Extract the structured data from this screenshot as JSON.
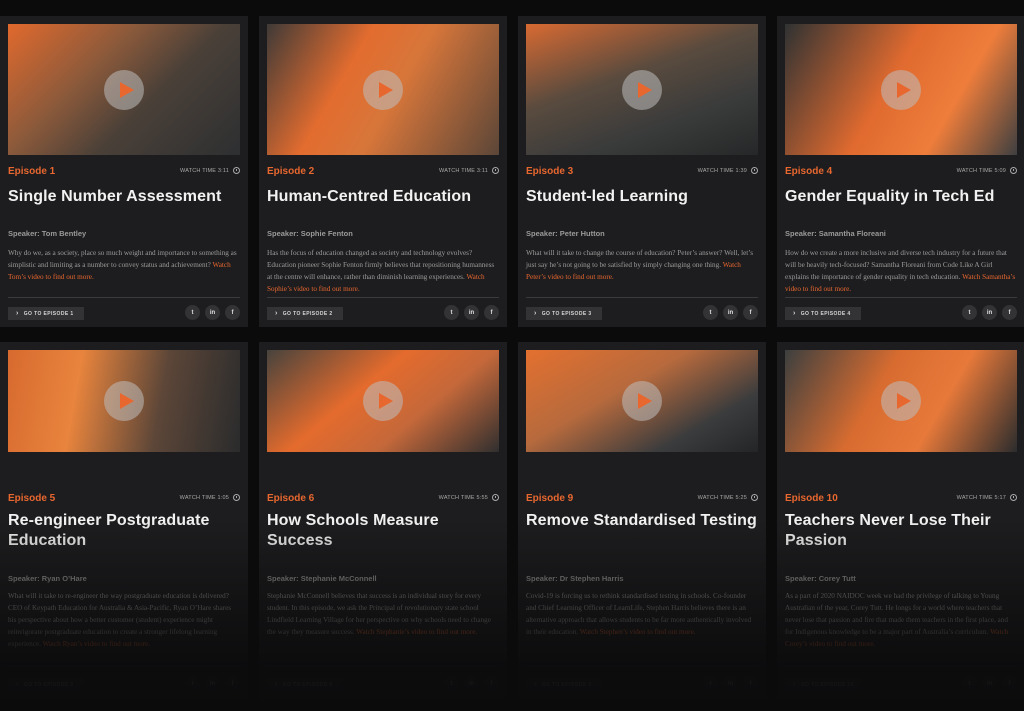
{
  "cards": [
    {
      "episode": "Episode 1",
      "watch": "WATCH TIME 3:11",
      "title": "Single Number Assessment",
      "speaker": "Speaker: Tom Bentley",
      "desc": "Why do we, as a society, place so much weight and importance to something as simplistic and limiting as a number to convey status and achievement?",
      "link": "Watch Tom’s video to find out more.",
      "go": "GO TO EPISODE 1"
    },
    {
      "episode": "Episode 2",
      "watch": "WATCH TIME 3:11",
      "title": "Human-Centred Education",
      "speaker": "Speaker: Sophie Fenton",
      "desc": "Has the focus of education changed as society and technology evolves? Education pioneer Sophie Fenton firmly believes that repositioning humanness at the centre will enhance, rather than diminish learning experiences.",
      "link": "Watch Sophie’s video to find out more.",
      "go": "GO TO EPISODE 2"
    },
    {
      "episode": "Episode 3",
      "watch": "WATCH TIME 1:39",
      "title": "Student-led Learning",
      "speaker": "Speaker: Peter Hutton",
      "desc": "What will it take to change the course of education? Peter’s answer? Well, let’s just say he’s not going to be satisfied by simply changing one thing.",
      "link": "Watch Peter’s video to find out more.",
      "go": "GO TO EPISODE 3"
    },
    {
      "episode": "Episode 4",
      "watch": "WATCH TIME 5:09",
      "title": "Gender Equality in Tech Ed",
      "speaker": "Speaker: Samantha Floreani",
      "desc": "How do we create a more inclusive and diverse tech industry for a future that will be heavily tech-focused? Samantha Floreani from Code Like A Girl explains the importance of gender equality in tech education.",
      "link": "Watch Samantha’s video to find out more.",
      "go": "GO TO EPISODE 4"
    },
    {
      "episode": "Episode 5",
      "watch": "WATCH TIME 1:05",
      "title": "Re-engineer Postgraduate Education",
      "speaker": "Speaker: Ryan O’Hare",
      "desc": "What will it take to re-engineer the way postgraduate education is delivered? CEO of Keypath Education for Australia & Asia-Pacific, Ryan O’Hare shares his perspective about how a better customer (student) experience might reinvigorate postgraduate education to create a stronger lifelong learning experience.",
      "link": "Watch Ryan’s video to find out more.",
      "go": "GO TO EPISODE 5"
    },
    {
      "episode": "Episode 6",
      "watch": "WATCH TIME 5:55",
      "title": "How Schools Measure Success",
      "speaker": "Speaker: Stephanie McConnell",
      "desc": "Stephanie McConnell believes that success is an individual story for every student. In this episode, we ask the Principal of revolutionary state school Lindfield Learning Village for her perspective on why schools need to change the way they measure success.",
      "link": "Watch Stephanie’s video to find out more.",
      "go": "GO TO EPISODE 6"
    },
    {
      "episode": "Episode 9",
      "watch": "WATCH TIME 5:25",
      "title": "Remove Standardised Testing",
      "speaker": "Speaker: Dr Stephen Harris",
      "desc": "Covid-19 is forcing us to rethink standardised testing in schools. Co-founder and Chief Learning Officer of LearnLife, Stephen Harris believes there is an alternative approach that allows students to be far more authentically involved in their education.",
      "link": "Watch Stephen’s video to find out more.",
      "go": "GO TO EPISODE 9"
    },
    {
      "episode": "Episode 10",
      "watch": "WATCH TIME 5:17",
      "title": "Teachers Never Lose Their Passion",
      "speaker": "Speaker: Corey Tutt",
      "desc": "As a part of 2020 NAIDOC week we had the privilege of talking to Young Australian of the year, Corey Tutt. He longs for a world where teachers that never lose that passion and fire that made them teachers in the first place, and for Indigenous knowledge to be a major part of Australia’s curriculum.",
      "link": "Watch Corey’s video to find out more.",
      "go": "GO TO EPISODE 10"
    }
  ],
  "social": {
    "twitter": "t",
    "linkedin": "in",
    "facebook": "f"
  },
  "icons": {
    "play": "play-icon",
    "clock": "clock-icon",
    "chevron": "chevron-right-icon"
  },
  "colors": {
    "accent": "#e8672f",
    "card": "#1d1d1f",
    "background": "#0b0b0c"
  }
}
